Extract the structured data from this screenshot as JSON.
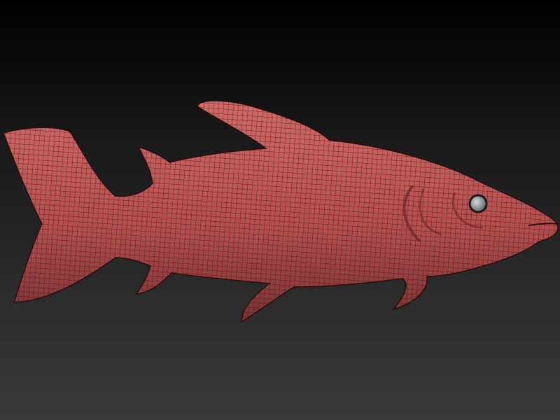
{
  "scene": {
    "subject": "fish-mesh",
    "colors": {
      "mesh": "#b5504f",
      "mesh_light": "#d06a68",
      "wire": "#3a1414",
      "eye": "#9aa0a0",
      "bg_top": "#000000",
      "bg_bottom": "#3a3a3a"
    }
  }
}
